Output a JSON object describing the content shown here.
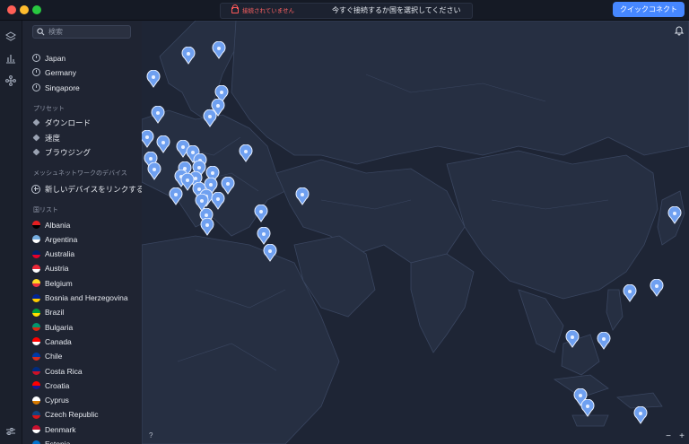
{
  "titlebar": {
    "status": "接続されていません",
    "title": "今すぐ接続するか国を選択してください",
    "quick_connect": "クイックコネクト"
  },
  "search": {
    "placeholder": "検索"
  },
  "recent": [
    "Japan",
    "Germany",
    "Singapore"
  ],
  "presets": {
    "label": "プリセット",
    "items": [
      "ダウンロード",
      "速度",
      "ブラウジング"
    ]
  },
  "mesh": {
    "label": "メッシュネットワークのデバイス",
    "link_label": "新しいデバイスをリンクする"
  },
  "countries": {
    "label": "国リスト",
    "items": [
      {
        "name": "Albania",
        "colors": [
          "#e41e20",
          "#000000"
        ]
      },
      {
        "name": "Argentina",
        "colors": [
          "#74acdf",
          "#ffffff"
        ]
      },
      {
        "name": "Australia",
        "colors": [
          "#012169",
          "#e4002b"
        ]
      },
      {
        "name": "Austria",
        "colors": [
          "#ed2939",
          "#ffffff"
        ]
      },
      {
        "name": "Belgium",
        "colors": [
          "#fdda24",
          "#ef3340"
        ]
      },
      {
        "name": "Bosnia and Herzegovina",
        "colors": [
          "#002395",
          "#fecb00"
        ]
      },
      {
        "name": "Brazil",
        "colors": [
          "#009c3b",
          "#ffdf00"
        ]
      },
      {
        "name": "Bulgaria",
        "colors": [
          "#00966e",
          "#d62612"
        ]
      },
      {
        "name": "Canada",
        "colors": [
          "#ff0000",
          "#ffffff"
        ]
      },
      {
        "name": "Chile",
        "colors": [
          "#0039a6",
          "#d52b1e"
        ]
      },
      {
        "name": "Costa Rica",
        "colors": [
          "#002b7f",
          "#ce1126"
        ]
      },
      {
        "name": "Croatia",
        "colors": [
          "#ff0000",
          "#171796"
        ]
      },
      {
        "name": "Cyprus",
        "colors": [
          "#ffffff",
          "#d57800"
        ]
      },
      {
        "name": "Czech Republic",
        "colors": [
          "#11457e",
          "#d7141a"
        ]
      },
      {
        "name": "Denmark",
        "colors": [
          "#c8102e",
          "#ffffff"
        ]
      },
      {
        "name": "Estonia",
        "colors": [
          "#0072ce",
          "#000000"
        ]
      }
    ]
  },
  "map": {
    "help": "?",
    "zoom_out": "−",
    "zoom_in": "+",
    "land_color": "#262f42",
    "water_color": "#1e2535",
    "pin_color": "#6fa0f0"
  }
}
